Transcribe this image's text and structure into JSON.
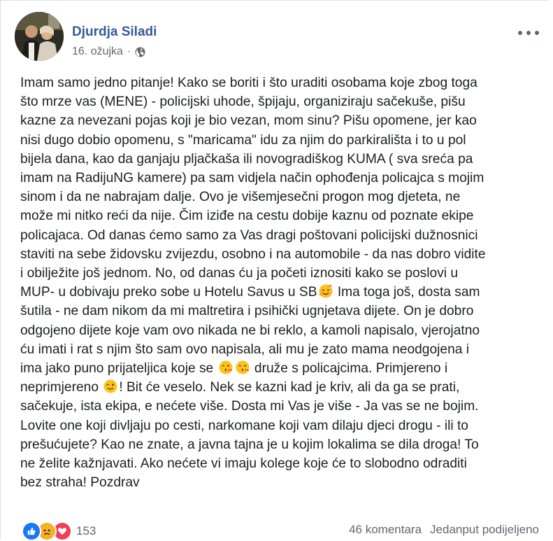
{
  "post": {
    "author": "Djurdja Siladi",
    "date": "16. ožujka",
    "separator": "·",
    "privacy_icon": "globe-icon",
    "more_icon": "more-options-icon",
    "lines": [
      {
        "text": "Imam samo jedno pitanje! Kako se boriti i što uraditi osobama koje zbog toga"
      },
      {
        "text": "što mrze vas (MENE) - policijski uhode, špijaju, organiziraju sačekuše, pišu"
      },
      {
        "text": "kazne za nevezani pojas koji je bio vezan, mom sinu? Pišu opomene, jer kao"
      },
      {
        "text": "nisi dugo dobio opomenu, s \"maricama\" idu za njim do parkirališta i to u pol"
      },
      {
        "text": "bijela dana, kao da ganjaju pljačkaša ili novogradiškog KUMA ( sva sreća pa"
      },
      {
        "text": "imam na RadijuNG kamere) pa sam vidjela način ophođenja policajca s mojim"
      },
      {
        "text": "sinom i da ne nabrajam dalje. Ovo je višemjesečni progon mog djeteta, ne"
      },
      {
        "text": "može mi nitko reći da nije. Čim iziđe na cestu dobije kaznu od poznate ekipe"
      },
      {
        "text": "policajaca. Od danas ćemo samo za Vas dragi poštovani policijski dužnosnici"
      },
      {
        "text": "staviti na sebe židovsku zvijezdu, osobno i na automobile - da nas dobro vidite"
      },
      {
        "text": "i obilježite još jednom. No, od danas ću ja početi iznositi kako se poslovi u"
      },
      {
        "text": "MUP- u dobivaju preko sobe u Hotelu Savus u SB",
        "emoji": [
          "smiling-face-with-hearts-emoji"
        ],
        "after": " Ima toga još, dosta sam"
      },
      {
        "text": "šutila - ne dam nikom da mi maltretira i psihički ugnjetava dijete. On je dobro"
      },
      {
        "text": "odgojeno dijete koje vam ovo nikada ne bi reklo, a kamoli napisalo, vjerojatno"
      },
      {
        "text": "ću imati i rat s njim što sam ovo napisala, ali mu je zato mama neodgojena i"
      },
      {
        "text": "ima jako puno prijateljica koje se ",
        "emoji": [
          "face-blowing-kiss-emoji",
          "face-blowing-kiss-emoji"
        ],
        "after": " druže s policajcima. Primjereno i"
      },
      {
        "text": "neprimjereno ",
        "emoji": [
          "winking-face-emoji"
        ],
        "after": "! Bit će veselo. Nek se kazni kad je kriv, ali da ga se prati,"
      },
      {
        "text": "sačekuje, ista ekipa, e nećete više. Dosta mi Vas je više - Ja vas se ne bojim."
      },
      {
        "text": "Lovite one koji divljaju po cesti, narkomane koji vam dilaju djeci drogu - ili to"
      },
      {
        "text": "prešućujete? Kao ne znate, a javna tajna je u kojim lokalima se dila droga! To"
      },
      {
        "text": "ne želite kažnjavati. Ako nećete vi imaju kolege koje će to slobodno odraditi"
      },
      {
        "text": "bez straha! Pozdrav"
      }
    ]
  },
  "footer": {
    "reaction_icons": [
      "like-reaction-icon",
      "sad-reaction-icon",
      "love-reaction-icon"
    ],
    "reaction_count": "153",
    "comments": "46 komentara",
    "shares": "Jedanput podijeljeno"
  },
  "colors": {
    "author": "#385898",
    "meta": "#616770",
    "text": "#1c1e21",
    "like": "#1877f2",
    "sad": "#f7b125",
    "love": "#f33e58"
  }
}
